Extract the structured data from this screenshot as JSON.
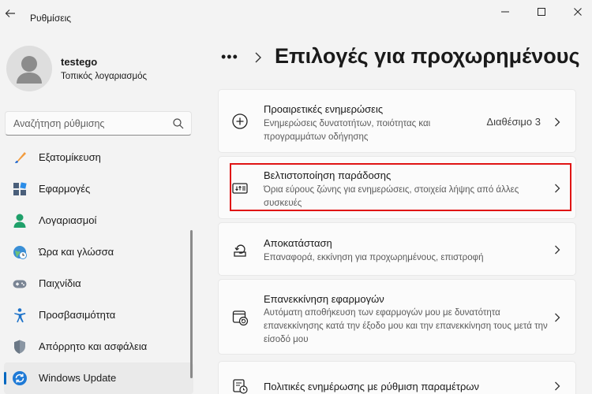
{
  "window": {
    "title": "Ρυθμίσεις"
  },
  "user": {
    "name": "testego",
    "account_type": "Τοπικός λογαριασμός"
  },
  "search": {
    "placeholder": "Αναζήτηση ρύθμισης"
  },
  "sidebar": {
    "items": [
      {
        "label": "Εξατομίκευση",
        "icon": "brush-icon"
      },
      {
        "label": "Εφαρμογές",
        "icon": "apps-icon"
      },
      {
        "label": "Λογαριασμοί",
        "icon": "person-icon"
      },
      {
        "label": "Ώρα και γλώσσα",
        "icon": "clock-globe-icon"
      },
      {
        "label": "Παιχνίδια",
        "icon": "gamepad-icon"
      },
      {
        "label": "Προσβασιμότητα",
        "icon": "accessibility-icon"
      },
      {
        "label": "Απόρρητο και ασφάλεια",
        "icon": "shield-icon"
      },
      {
        "label": "Windows Update",
        "icon": "update-icon",
        "active": true
      }
    ]
  },
  "header": {
    "more": "•••",
    "title": "Επιλογές για προχωρημένους"
  },
  "cards": [
    {
      "title": "Προαιρετικές ενημερώσεις",
      "desc": "Ενημερώσεις δυνατοτήτων, ποιότητας και προγραμμάτων οδήγησης",
      "value": "Διαθέσιμο 3",
      "icon": "plus-circle-icon"
    },
    {
      "title": "Βελτιστοποίηση παράδοσης",
      "desc": "Όρια εύρους ζώνης για ενημερώσεις, στοιχεία λήψης από άλλες συσκευές",
      "icon": "delivery-optimization-icon"
    },
    {
      "title": "Αποκατάσταση",
      "desc": "Επαναφορά, εκκίνηση για προχωρημένους, επιστροφή",
      "icon": "recovery-icon"
    },
    {
      "title": "Επανεκκίνηση εφαρμογών",
      "desc": "Αυτόματη αποθήκευση των εφαρμογών μου με δυνατότητα επανεκκίνησης κατά την έξοδο μου και την επανεκκίνηση τους μετά την είσοδό μου",
      "icon": "restart-apps-icon"
    },
    {
      "title": "Πολιτικές ενημέρωσης με ρύθμιση παραμέτρων",
      "icon": "policy-icon"
    }
  ],
  "colors": {
    "accent": "#0067c0",
    "highlight": "#e01414"
  }
}
